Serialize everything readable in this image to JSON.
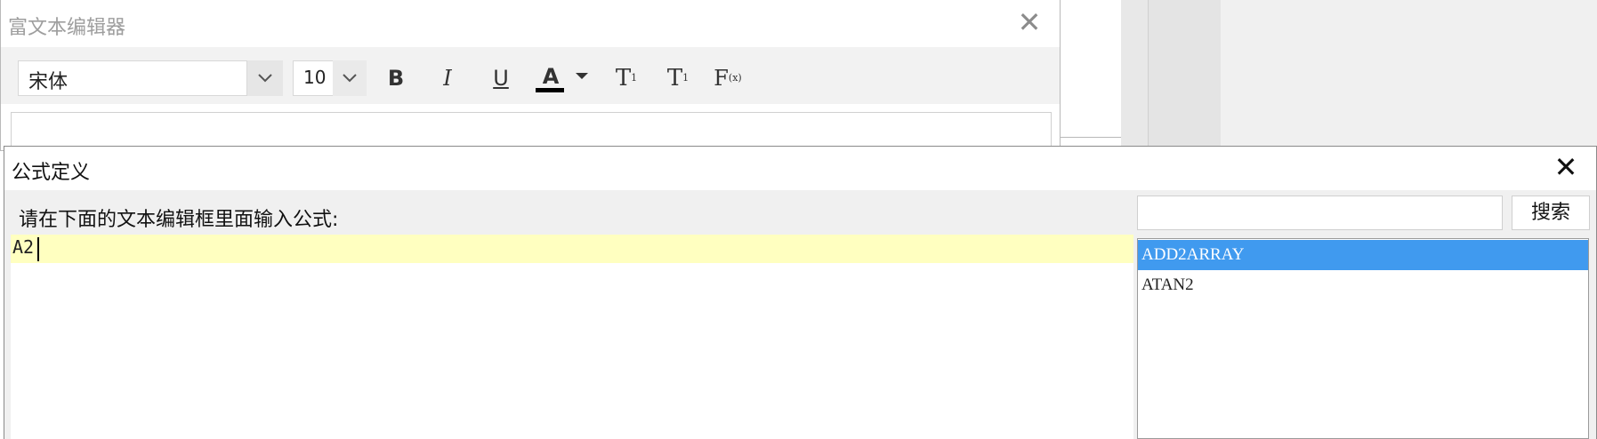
{
  "rich_text_editor": {
    "title": "富文本编辑器",
    "close_icon": "✕",
    "toolbar": {
      "font_family": "宋体",
      "font_size": "10",
      "bold_label": "B",
      "italic_label": "I",
      "underline_label": "U",
      "color_label": "A",
      "superscript_label": "T",
      "superscript_mark": "1",
      "subscript_label": "T",
      "subscript_mark": "1",
      "formula_label": "F",
      "formula_mark": "(x)",
      "color_bar": "#000000"
    }
  },
  "formula_dialog": {
    "title": "公式定义",
    "close_icon": "✕",
    "prompt": "请在下面的文本编辑框里面输入公式:",
    "formula_value": "A2",
    "search_value": "",
    "search_button": "搜索",
    "functions": [
      {
        "name": "ADD2ARRAY",
        "selected": true
      },
      {
        "name": "ATAN2",
        "selected": false
      }
    ],
    "colors": {
      "formula_highlight": "#ffffc0",
      "selection": "#409aef"
    }
  }
}
